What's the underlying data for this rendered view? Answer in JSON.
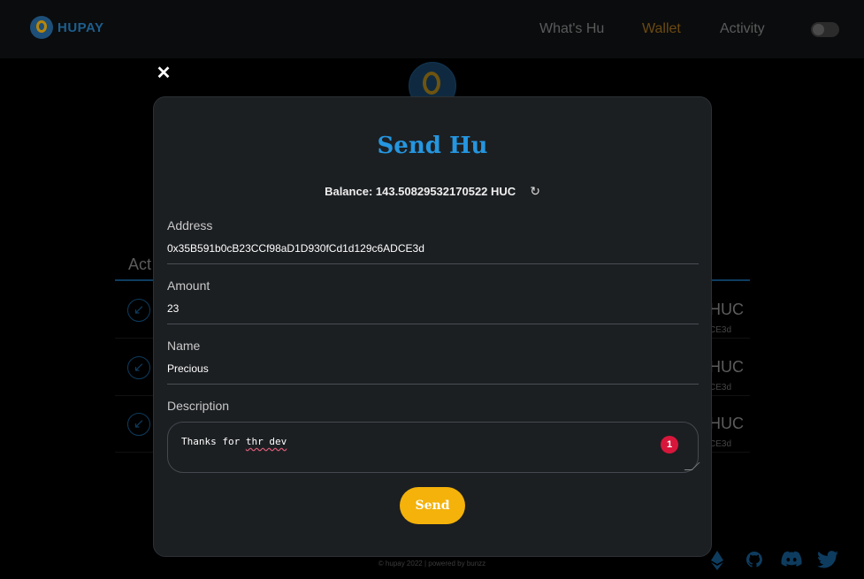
{
  "header": {
    "logo_text": "HUPAY",
    "nav": {
      "whats_hu": "What's Hu",
      "wallet": "Wallet",
      "activity": "Activity"
    }
  },
  "activity": {
    "tab_label": "Act",
    "rows": [
      {
        "amount": "HUC",
        "address": "CE3d"
      },
      {
        "amount": "HUC",
        "address": "CE3d"
      },
      {
        "amount": "HUC",
        "address": "CE3d"
      }
    ]
  },
  "footer": {
    "text": "© hupay 2022 | powered by bunzz"
  },
  "modal": {
    "close_icon": "close-icon",
    "title": "Send Hu",
    "balance": "Balance: 143.50829532170522 HUC",
    "address": {
      "label": "Address",
      "value": "0x35B591b0cB23CCf98aD1D930fCd1d129c6ADCE3d"
    },
    "amount": {
      "label": "Amount",
      "value": "23"
    },
    "name": {
      "label": "Name",
      "value": "Precious"
    },
    "description": {
      "label": "Description",
      "text_prefix": "Thanks for ",
      "text_misspelled": "thr dev",
      "badge": "1"
    },
    "send_label": "Send"
  },
  "social_icons": [
    "ethereum-icon",
    "github-icon",
    "discord-icon",
    "twitter-icon"
  ],
  "colors": {
    "title": "#2596e0",
    "send_button": "#f4b20a",
    "modal_bg": "#1c1f22",
    "badge": "#d8163b"
  }
}
